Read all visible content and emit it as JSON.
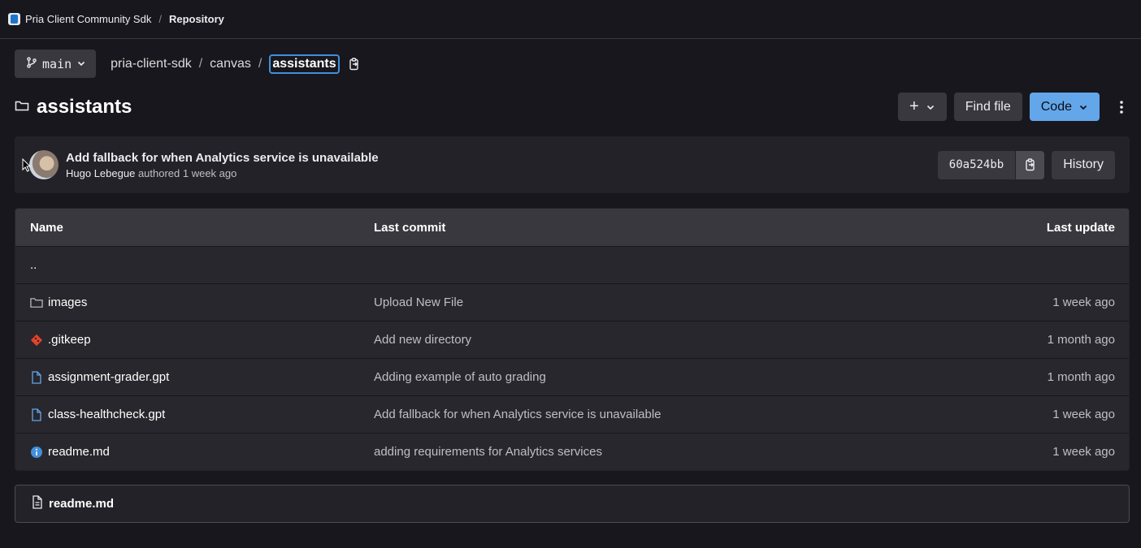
{
  "topbar": {
    "project_name": "Pria Client Community Sdk",
    "separator": "/",
    "page": "Repository"
  },
  "branch": {
    "name": "main",
    "path": [
      "pria-client-sdk",
      "canvas"
    ],
    "current": "assistants",
    "separator": "/"
  },
  "header": {
    "title": "assistants",
    "add_label": "+",
    "find_file_label": "Find file",
    "code_label": "Code"
  },
  "commit": {
    "message": "Add fallback for when Analytics service is unavailable",
    "author": "Hugo Lebegue",
    "authored_text": "authored 1 week ago",
    "sha": "60a524bb",
    "history_label": "History"
  },
  "table": {
    "headers": {
      "name": "Name",
      "last_commit": "Last commit",
      "last_update": "Last update"
    },
    "parent_dir": "..",
    "rows": [
      {
        "name": "images",
        "icon": "folder-icon",
        "commit": "Upload New File",
        "updated": "1 week ago"
      },
      {
        "name": ".gitkeep",
        "icon": "git-icon",
        "commit": "Add new directory",
        "updated": "1 month ago"
      },
      {
        "name": "assignment-grader.gpt",
        "icon": "file-icon",
        "commit": "Adding example of auto grading",
        "updated": "1 month ago"
      },
      {
        "name": "class-healthcheck.gpt",
        "icon": "file-icon",
        "commit": "Add fallback for when Analytics service is unavailable",
        "updated": "1 week ago"
      },
      {
        "name": "readme.md",
        "icon": "info-icon",
        "commit": "adding requirements for Analytics services",
        "updated": "1 week ago"
      }
    ]
  },
  "readme": {
    "filename": "readme.md"
  },
  "colors": {
    "accent": "#63a6e9",
    "gitkeep_icon": "#e24329",
    "info_icon": "#428fdc"
  }
}
